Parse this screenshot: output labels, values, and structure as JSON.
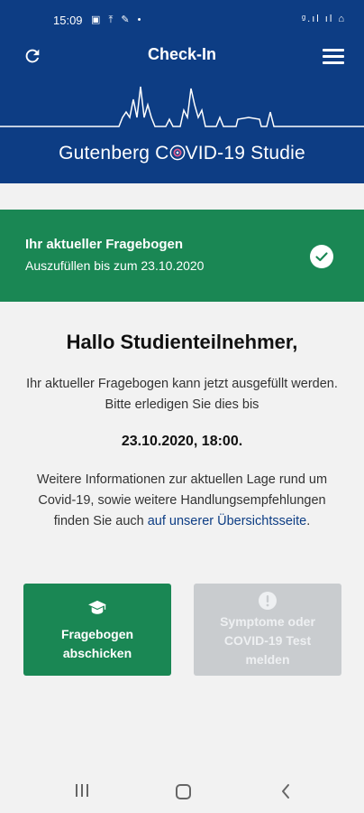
{
  "status_bar": {
    "time": "15:09",
    "left_icons": "▣ ⤒ ✎ •",
    "right_icons": "ᵍ.ıl ıl ⌂"
  },
  "app_bar": {
    "title": "Check-In",
    "refresh_icon": "refresh-icon",
    "menu_icon": "menu-icon"
  },
  "brand": {
    "text_before": "Gutenberg C",
    "text_after": "VID-19 Studie"
  },
  "questionnaire_banner": {
    "title": "Ihr aktueller Fragebogen",
    "subtitle": "Auszufüllen bis zum 23.10.2020",
    "icon": "check-icon"
  },
  "main": {
    "greeting": "Hallo Studienteilnehmer,",
    "intro": "Ihr aktueller Fragebogen kann jetzt ausgefüllt werden. Bitte erledigen Sie dies bis",
    "deadline": "23.10.2020, 18:00.",
    "info_text": "Weitere Informationen zur aktuellen Lage rund um Covid-19, sowie weitere Handlungsempfehlungen finden Sie auch ",
    "info_link": "auf unserer Übersichtsseite",
    "info_end": "."
  },
  "buttons": {
    "submit_line1": "Fragebogen",
    "submit_line2": "abschicken",
    "report_line1": "Symptome oder",
    "report_line2": "COVID-19 Test",
    "report_line3": "melden"
  },
  "colors": {
    "header": "#0d3d84",
    "green": "#1a8754",
    "disabled": "#c9cccf",
    "background": "#f2f2f2"
  }
}
